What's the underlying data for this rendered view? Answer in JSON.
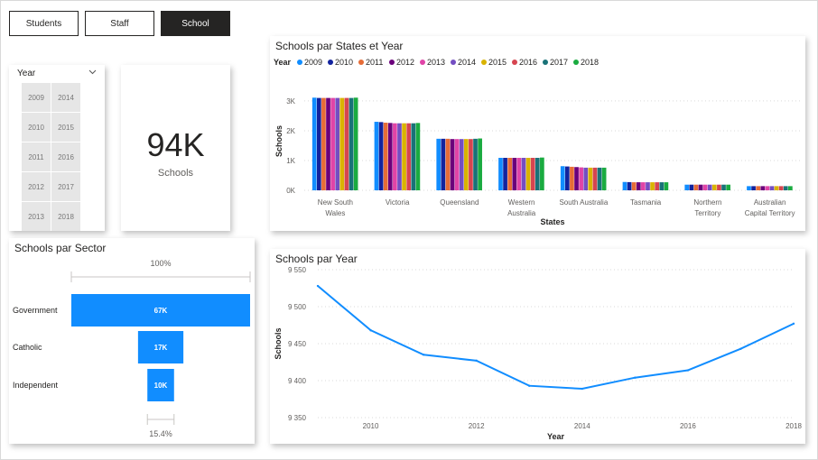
{
  "nav": {
    "students_label": "Students",
    "staff_label": "Staff",
    "school_label": "School"
  },
  "year_slicer": {
    "title": "Year",
    "years": [
      "2009",
      "2014",
      "2010",
      "2015",
      "2011",
      "2016",
      "2012",
      "2017",
      "2013",
      "2018"
    ]
  },
  "kpi": {
    "value": "94K",
    "label": "Schools"
  },
  "colors": {
    "accent": "#118DFF",
    "years": [
      "#118DFF",
      "#12239E",
      "#E66C37",
      "#6B007B",
      "#E044A7",
      "#744EC2",
      "#D9B300",
      "#D64550",
      "#197278",
      "#1AAB40"
    ]
  },
  "chart_data": [
    {
      "type": "bar",
      "title": "Schools par States et Year",
      "legend_title": "Year",
      "legend_position": "top-left",
      "xlabel": "States",
      "ylabel": "Schools",
      "ylim": [
        0,
        3300
      ],
      "yticks": [
        0,
        1000,
        2000,
        3000
      ],
      "ytick_labels": [
        "0K",
        "1K",
        "2K",
        "3K"
      ],
      "categories": [
        [
          "New South",
          "Wales"
        ],
        [
          "Victoria"
        ],
        [
          "Queensland"
        ],
        [
          "Western",
          "Australia"
        ],
        [
          "South Australia"
        ],
        [
          "Tasmania"
        ],
        [
          "Northern",
          "Territory"
        ],
        [
          "Australian",
          "Capital Territory"
        ]
      ],
      "series": [
        {
          "name": "2009",
          "values": [
            3110,
            2300,
            1730,
            1090,
            810,
            280,
            190,
            140
          ]
        },
        {
          "name": "2010",
          "values": [
            3100,
            2290,
            1730,
            1090,
            800,
            275,
            190,
            140
          ]
        },
        {
          "name": "2011",
          "values": [
            3100,
            2270,
            1730,
            1090,
            790,
            270,
            190,
            140
          ]
        },
        {
          "name": "2012",
          "values": [
            3100,
            2260,
            1720,
            1090,
            780,
            270,
            190,
            140
          ]
        },
        {
          "name": "2013",
          "values": [
            3100,
            2250,
            1720,
            1090,
            770,
            270,
            190,
            140
          ]
        },
        {
          "name": "2014",
          "values": [
            3100,
            2250,
            1720,
            1090,
            760,
            270,
            190,
            140
          ]
        },
        {
          "name": "2015",
          "values": [
            3100,
            2250,
            1720,
            1090,
            760,
            270,
            190,
            140
          ]
        },
        {
          "name": "2016",
          "values": [
            3100,
            2250,
            1720,
            1090,
            760,
            270,
            190,
            140
          ]
        },
        {
          "name": "2017",
          "values": [
            3100,
            2250,
            1730,
            1090,
            760,
            270,
            190,
            140
          ]
        },
        {
          "name": "2018",
          "values": [
            3110,
            2260,
            1740,
            1100,
            760,
            270,
            190,
            140
          ]
        }
      ],
      "grid": true
    },
    {
      "type": "bar",
      "subtype": "funnel",
      "title": "Schools par Sector",
      "categories": [
        "Government",
        "Catholic",
        "Independent"
      ],
      "values": [
        67,
        17,
        10
      ],
      "value_labels": [
        "67K",
        "17K",
        "10K"
      ],
      "top_label": "100%",
      "bottom_label": "15.4%"
    },
    {
      "type": "line",
      "title": "Schools par Year",
      "xlabel": "Year",
      "ylabel": "Schools",
      "x": [
        2009,
        2010,
        2011,
        2012,
        2013,
        2014,
        2015,
        2016,
        2017,
        2018
      ],
      "values": [
        9528,
        9468,
        9435,
        9427,
        9393,
        9389,
        9404,
        9414,
        9443,
        9477
      ],
      "ylim": [
        9350,
        9550
      ],
      "yticks": [
        9350,
        9400,
        9450,
        9500,
        9550
      ],
      "ytick_labels": [
        "9 350",
        "9 400",
        "9 450",
        "9 500",
        "9 550"
      ],
      "xticks": [
        2010,
        2012,
        2014,
        2016,
        2018
      ],
      "grid": true
    }
  ]
}
